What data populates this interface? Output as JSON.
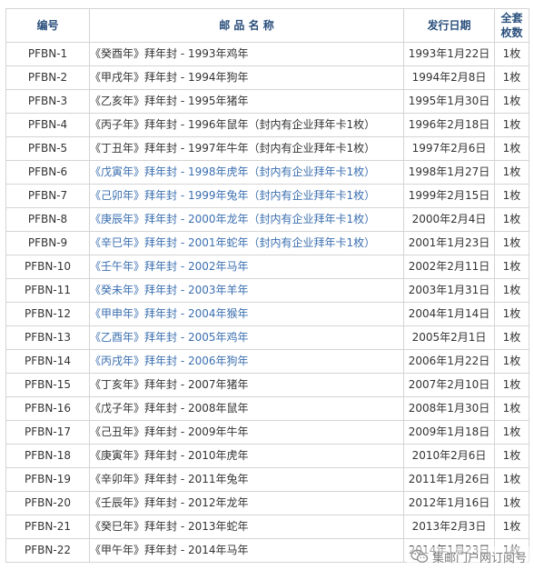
{
  "table": {
    "headers": {
      "code": "编号",
      "name": "邮 品 名 称",
      "date": "发行日期",
      "qty_line1": "全套",
      "qty_line2": "枚数"
    },
    "rows": [
      {
        "code": "PFBN-1",
        "name": "《癸酉年》拜年封 - 1993年鸡年",
        "date": "1993年1月22日",
        "qty": "1枚",
        "linked": false
      },
      {
        "code": "PFBN-2",
        "name": "《甲戌年》拜年封 - 1994年狗年",
        "date": "1994年2月8日",
        "qty": "1枚",
        "linked": false
      },
      {
        "code": "PFBN-3",
        "name": "《乙亥年》拜年封 - 1995年猪年",
        "date": "1995年1月30日",
        "qty": "1枚",
        "linked": false
      },
      {
        "code": "PFBN-4",
        "name": "《丙子年》拜年封 - 1996年鼠年（封内有企业拜年卡1枚）",
        "date": "1996年2月18日",
        "qty": "1枚",
        "linked": false
      },
      {
        "code": "PFBN-5",
        "name": "《丁丑年》拜年封 - 1997年牛年（封内有企业拜年卡1枚）",
        "date": "1997年2月6日",
        "qty": "1枚",
        "linked": false
      },
      {
        "code": "PFBN-6",
        "name": "《戊寅年》拜年封 - 1998年虎年（封内有企业拜年卡1枚）",
        "date": "1998年1月27日",
        "qty": "1枚",
        "linked": true
      },
      {
        "code": "PFBN-7",
        "name": "《己卯年》拜年封 - 1999年兔年（封内有企业拜年卡1枚）",
        "date": "1999年2月15日",
        "qty": "1枚",
        "linked": true
      },
      {
        "code": "PFBN-8",
        "name": "《庚辰年》拜年封 - 2000年龙年（封内有企业拜年卡1枚）",
        "date": "2000年2月4日",
        "qty": "1枚",
        "linked": true
      },
      {
        "code": "PFBN-9",
        "name": "《辛巳年》拜年封 - 2001年蛇年（封内有企业拜年卡1枚）",
        "date": "2001年1月23日",
        "qty": "1枚",
        "linked": true
      },
      {
        "code": "PFBN-10",
        "name": "《壬午年》拜年封 - 2002年马年",
        "date": "2002年2月11日",
        "qty": "1枚",
        "linked": true
      },
      {
        "code": "PFBN-11",
        "name": "《癸未年》拜年封 - 2003年羊年",
        "date": "2003年1月31日",
        "qty": "1枚",
        "linked": true
      },
      {
        "code": "PFBN-12",
        "name": "《甲申年》拜年封 - 2004年猴年",
        "date": "2004年1月14日",
        "qty": "1枚",
        "linked": true
      },
      {
        "code": "PFBN-13",
        "name": "《乙酉年》拜年封 - 2005年鸡年",
        "date": "2005年2月1日",
        "qty": "1枚",
        "linked": true
      },
      {
        "code": "PFBN-14",
        "name": "《丙戌年》拜年封 - 2006年狗年",
        "date": "2006年1月22日",
        "qty": "1枚",
        "linked": true
      },
      {
        "code": "PFBN-15",
        "name": "《丁亥年》拜年封 - 2007年猪年",
        "date": "2007年2月10日",
        "qty": "1枚",
        "linked": false
      },
      {
        "code": "PFBN-16",
        "name": "《戊子年》拜年封 - 2008年鼠年",
        "date": "2008年1月30日",
        "qty": "1枚",
        "linked": false
      },
      {
        "code": "PFBN-17",
        "name": "《己丑年》拜年封 - 2009年牛年",
        "date": "2009年1月18日",
        "qty": "1枚",
        "linked": false
      },
      {
        "code": "PFBN-18",
        "name": "《庚寅年》拜年封 - 2010年虎年",
        "date": "2010年2月6日",
        "qty": "1枚",
        "linked": false
      },
      {
        "code": "PFBN-19",
        "name": "《辛卯年》拜年封 - 2011年兔年",
        "date": "2011年1月26日",
        "qty": "1枚",
        "linked": false
      },
      {
        "code": "PFBN-20",
        "name": "《壬辰年》拜年封 - 2012年龙年",
        "date": "2012年1月16日",
        "qty": "1枚",
        "linked": false
      },
      {
        "code": "PFBN-21",
        "name": "《癸巳年》拜年封 - 2013年蛇年",
        "date": "2013年2月3日",
        "qty": "1枚",
        "linked": false
      },
      {
        "code": "PFBN-22",
        "name": "《甲午年》拜年封 - 2014年马年",
        "date": "2014年1月23日",
        "qty": "1枚",
        "linked": false
      }
    ]
  },
  "watermark": {
    "text": "集邮门户网订阅号",
    "icon": "wechat-icon"
  },
  "colors": {
    "header_text": "#2a4f7c",
    "link_text": "#3b6fb0",
    "body_text": "#333333",
    "border": "#d4d4d4"
  }
}
